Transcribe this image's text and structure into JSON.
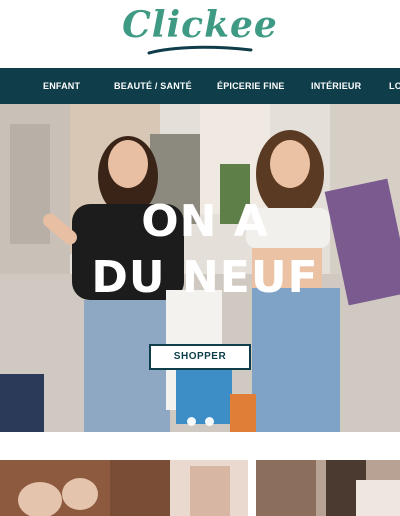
{
  "brand": {
    "name": "Clickee",
    "color": "#3f9a84"
  },
  "nav": {
    "items": [
      {
        "label": "ENFANT"
      },
      {
        "label": "BEAUTÉ / SANTÉ"
      },
      {
        "label": "ÉPICERIE FINE"
      },
      {
        "label": "INTÉRIEUR"
      },
      {
        "label": "LO"
      }
    ],
    "background": "#0f3d4a"
  },
  "hero": {
    "title_line1": "ON A",
    "title_line2": "DU NEUF",
    "cta_label": "SHOPPER",
    "slide_count": 2
  },
  "colors": {
    "accent": "#0f3d4a",
    "brand": "#3f9a84"
  }
}
